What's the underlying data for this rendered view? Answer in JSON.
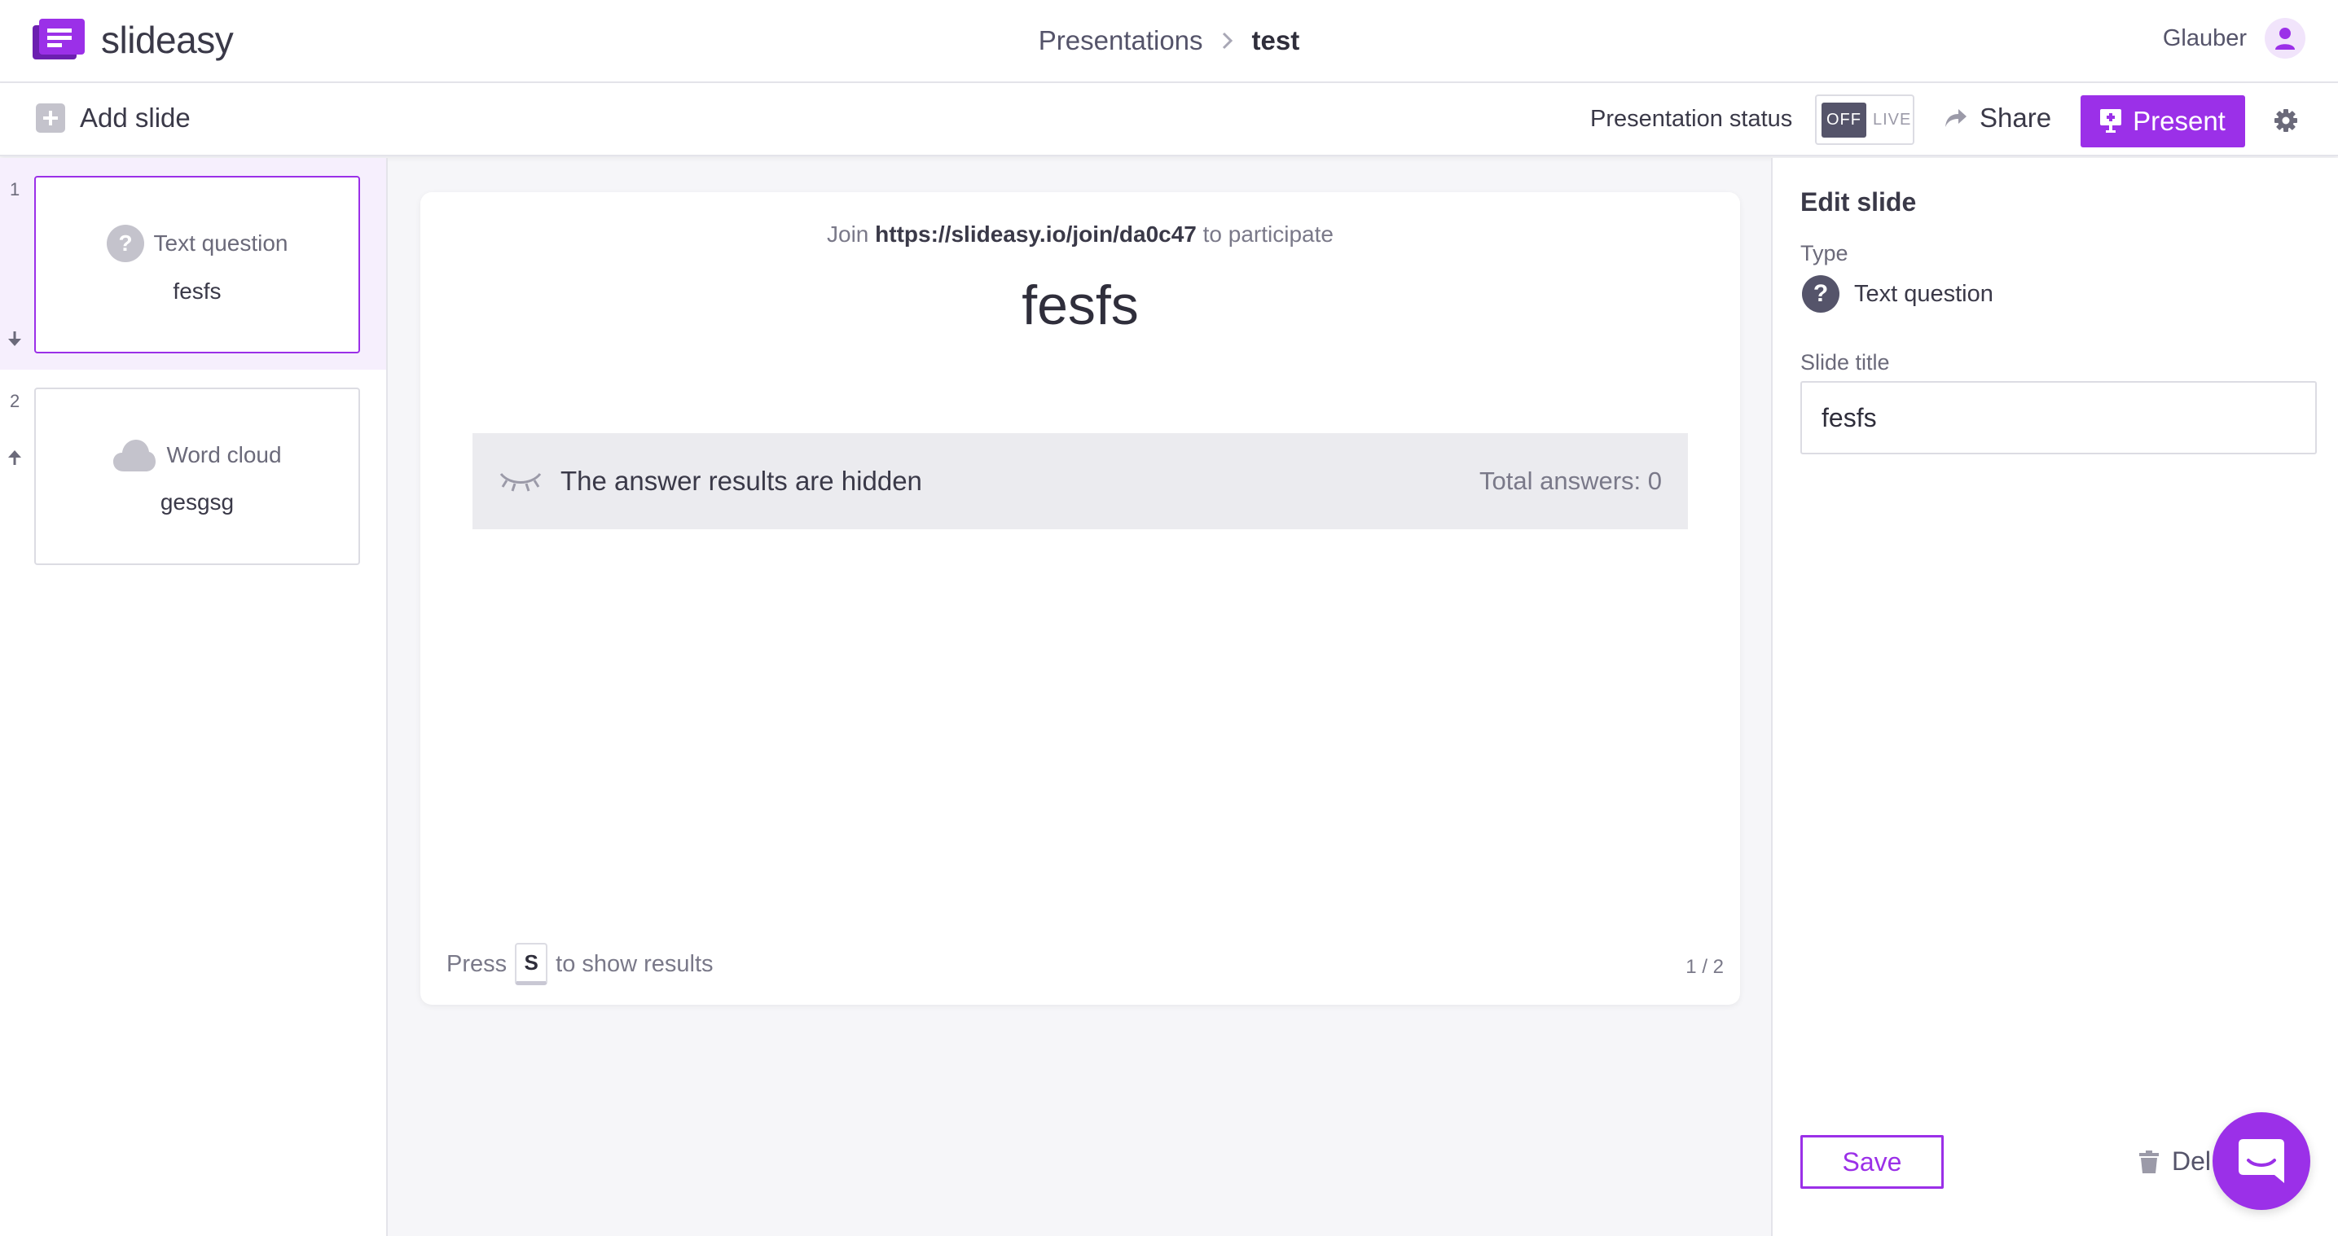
{
  "app": {
    "logo_text": "slideasy",
    "accent_color": "#9b30e8"
  },
  "header": {
    "breadcrumb": {
      "parent": "Presentations",
      "current": "test"
    },
    "user_name": "Glauber"
  },
  "toolbar": {
    "add_slide_label": "Add slide",
    "status_label": "Presentation status",
    "toggle_off": "OFF",
    "toggle_live": "LIVE",
    "share_label": "Share",
    "present_label": "Present"
  },
  "slides": [
    {
      "number": "1",
      "type": "Text question",
      "title": "fesfs",
      "icon": "question-circle-icon"
    },
    {
      "number": "2",
      "type": "Word cloud",
      "title": "gesgsg",
      "icon": "cloud-icon"
    }
  ],
  "canvas": {
    "join_prefix": "Join",
    "join_url": "https://slideasy.io/join/da0c47",
    "join_suffix": "to participate",
    "slide_title": "fesfs",
    "hidden_message": "The answer results are hidden",
    "total_answers": "Total answers: 0",
    "press_prefix": "Press",
    "press_key": "S",
    "press_suffix": "to show results",
    "pager": "1 / 2"
  },
  "edit_panel": {
    "heading": "Edit slide",
    "type_label": "Type",
    "type_value": "Text question",
    "title_label": "Slide title",
    "title_value": "fesfs",
    "save_label": "Save",
    "delete_label": "Del"
  }
}
